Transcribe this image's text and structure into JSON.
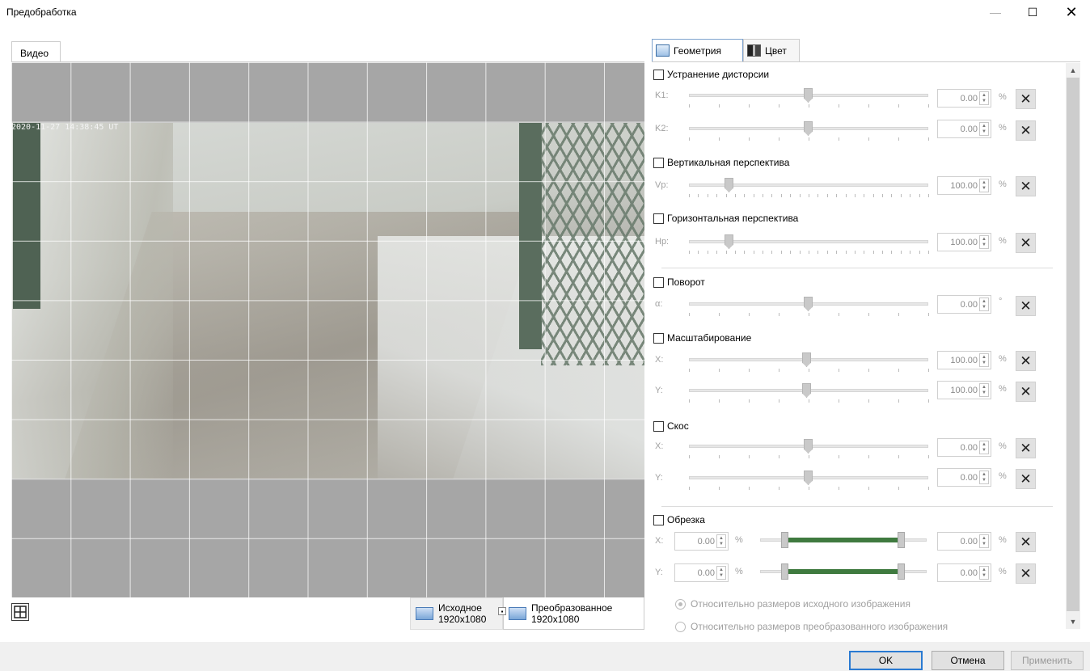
{
  "window": {
    "title": "Предобработка",
    "minimize": "—",
    "maximize": "☐",
    "close": "✕"
  },
  "video": {
    "tab_label": "Видео",
    "timestamp": "2020-11-27 14:38:45 UT",
    "source_btn": {
      "label": "Исходное",
      "size": "1920x1080"
    },
    "transformed_btn": {
      "label": "Преобразованное",
      "size": "1920x1080"
    }
  },
  "tabs": {
    "geometry": "Геометрия",
    "color": "Цвет"
  },
  "distortion": {
    "label": "Устранение дисторсии",
    "k1": {
      "label": "K1:",
      "value": "0.00",
      "unit": "%"
    },
    "k2": {
      "label": "K2:",
      "value": "0.00",
      "unit": "%"
    }
  },
  "vertical": {
    "label": "Вертикальная перспектива",
    "vp": {
      "label": "Vp:",
      "value": "100.00",
      "unit": "%"
    }
  },
  "horizontal": {
    "label": "Горизонтальная перспектива",
    "hp": {
      "label": "Hp:",
      "value": "100.00",
      "unit": "%"
    }
  },
  "rotation": {
    "label": "Поворот",
    "a": {
      "label": "α:",
      "value": "0.00",
      "unit": "°"
    }
  },
  "scaling": {
    "label": "Масштабирование",
    "x": {
      "label": "X:",
      "value": "100.00",
      "unit": "%"
    },
    "y": {
      "label": "Y:",
      "value": "100.00",
      "unit": "%"
    }
  },
  "skew": {
    "label": "Скос",
    "x": {
      "label": "X:",
      "value": "0.00",
      "unit": "%"
    },
    "y": {
      "label": "Y:",
      "value": "0.00",
      "unit": "%"
    }
  },
  "crop": {
    "label": "Обрезка",
    "x": {
      "label": "X:",
      "from": "0.00",
      "to": "0.00",
      "unit": "%"
    },
    "y": {
      "label": "Y:",
      "from": "0.00",
      "to": "0.00",
      "unit": "%"
    },
    "relative_source": "Относительно размеров исходного изображения",
    "relative_transformed": "Относительно размеров преобразованного изображения"
  },
  "footer": {
    "ok": "OK",
    "cancel": "Отмена",
    "apply": "Применить"
  },
  "colors": {
    "accent": "#2a7ad2",
    "crop_fill": "#3f7a3f"
  },
  "icons": [
    "grid-icon",
    "geometry-tab-icon",
    "color-tab-icon",
    "reset-icon",
    "source-image-icon",
    "transformed-image-icon"
  ]
}
